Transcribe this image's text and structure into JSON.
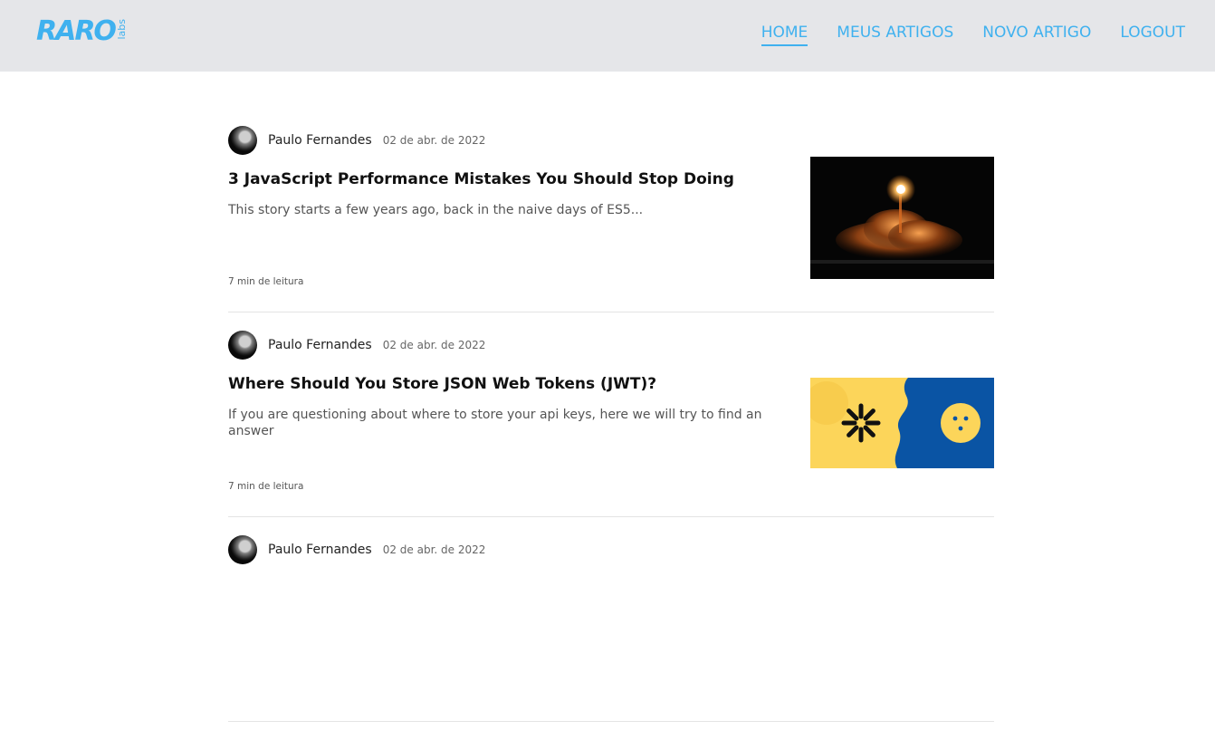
{
  "header": {
    "logo": {
      "main": "RARO",
      "sub": "labs"
    },
    "nav": [
      {
        "label": "HOME",
        "active": true
      },
      {
        "label": "MEUS ARTIGOS",
        "active": false
      },
      {
        "label": "NOVO ARTIGO",
        "active": false
      },
      {
        "label": "LOGOUT",
        "active": false
      }
    ]
  },
  "posts": [
    {
      "author": "Paulo Fernandes",
      "date": "02 de abr. de 2022",
      "title": "3 JavaScript Performance Mistakes You Should Stop Doing",
      "excerpt": "This story starts a few years ago, back in the naive days of ES5...",
      "reading_time": "7 min de leitura",
      "image": "rocket-launch-photo"
    },
    {
      "author": "Paulo Fernandes",
      "date": "02 de abr. de 2022",
      "title": "Where Should You Store JSON Web Tokens (JWT)?",
      "excerpt": "If you are questioning about where to store your api keys, here we will try to find an answer",
      "reading_time": "7 min de leitura",
      "image": "jwt-cookie-illustration"
    },
    {
      "author": "Paulo Fernandes",
      "date": "02 de abr. de 2022"
    }
  ],
  "colors": {
    "accent": "#3fb1ef",
    "header_bg": "#e5e6e9",
    "jwt_yellow": "#fcd55a",
    "jwt_blue": "#0a54a4"
  }
}
